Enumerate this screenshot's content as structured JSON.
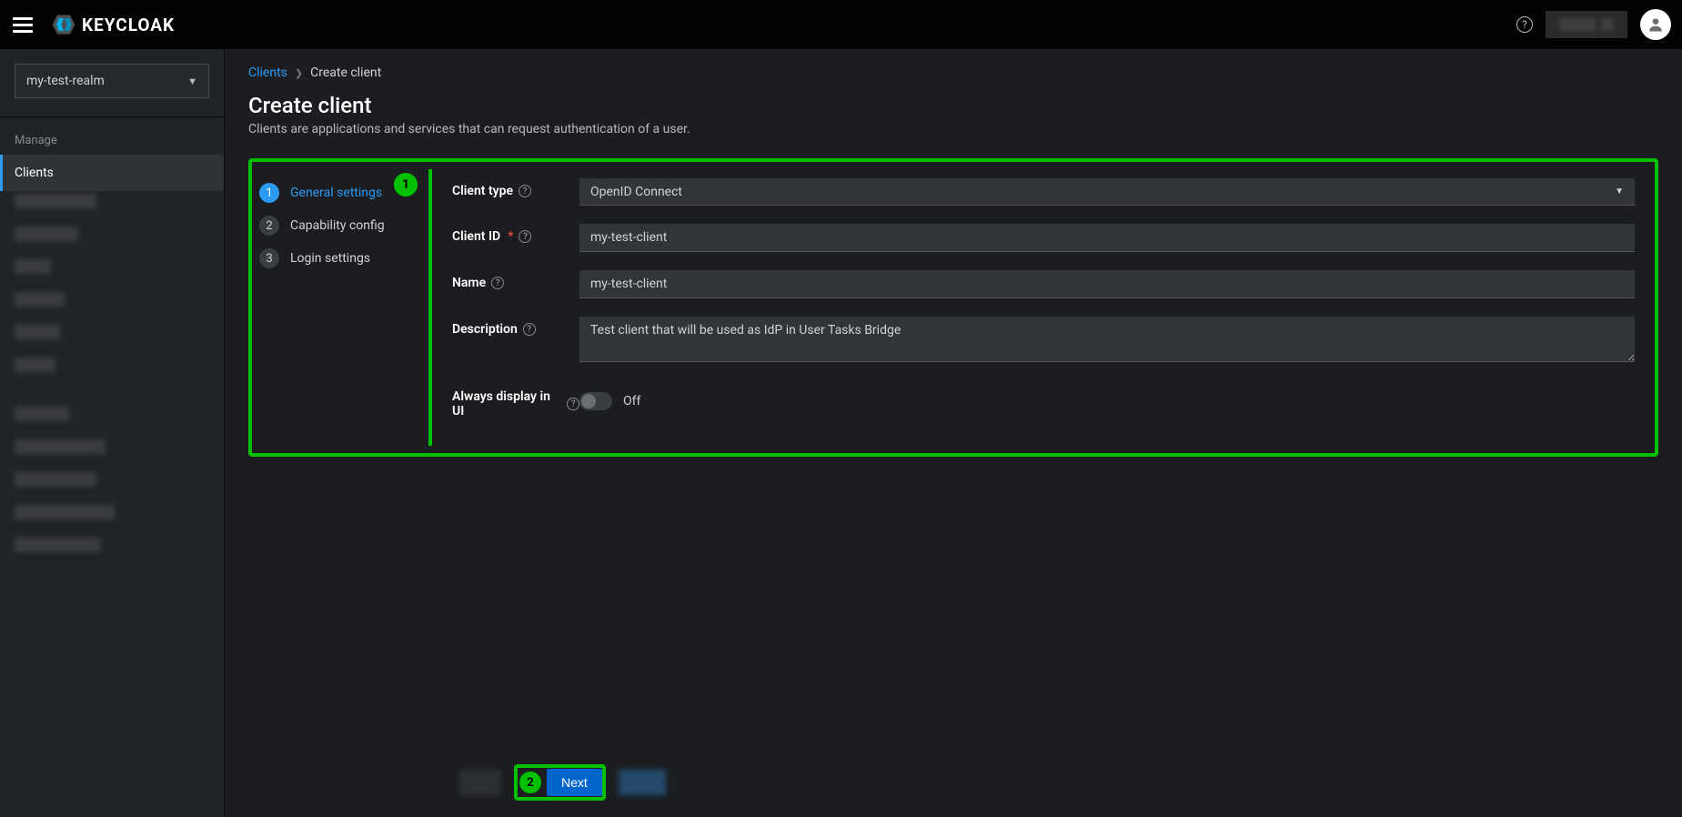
{
  "brand": "KEYCLOAK",
  "realm_selector": {
    "value": "my-test-realm"
  },
  "sidebar": {
    "section_title": "Manage",
    "items": [
      {
        "label": "Clients",
        "active": true
      }
    ]
  },
  "breadcrumb": {
    "parent": "Clients",
    "current": "Create client"
  },
  "page": {
    "title": "Create client",
    "description": "Clients are applications and services that can request authentication of a user."
  },
  "wizard": {
    "steps": [
      {
        "num": "1",
        "label": "General settings",
        "active": true
      },
      {
        "num": "2",
        "label": "Capability config",
        "active": false
      },
      {
        "num": "3",
        "label": "Login settings",
        "active": false
      }
    ]
  },
  "form": {
    "client_type": {
      "label": "Client type",
      "value": "OpenID Connect"
    },
    "client_id": {
      "label": "Client ID",
      "value": "my-test-client",
      "required": true
    },
    "name": {
      "label": "Name",
      "value": "my-test-client"
    },
    "description": {
      "label": "Description",
      "value": "Test client that will be used as IdP in User Tasks Bridge"
    },
    "always_display": {
      "label": "Always display in UI",
      "value_label": "Off"
    }
  },
  "footer": {
    "next": "Next"
  },
  "annotations": {
    "badge1": "1",
    "badge2": "2"
  }
}
